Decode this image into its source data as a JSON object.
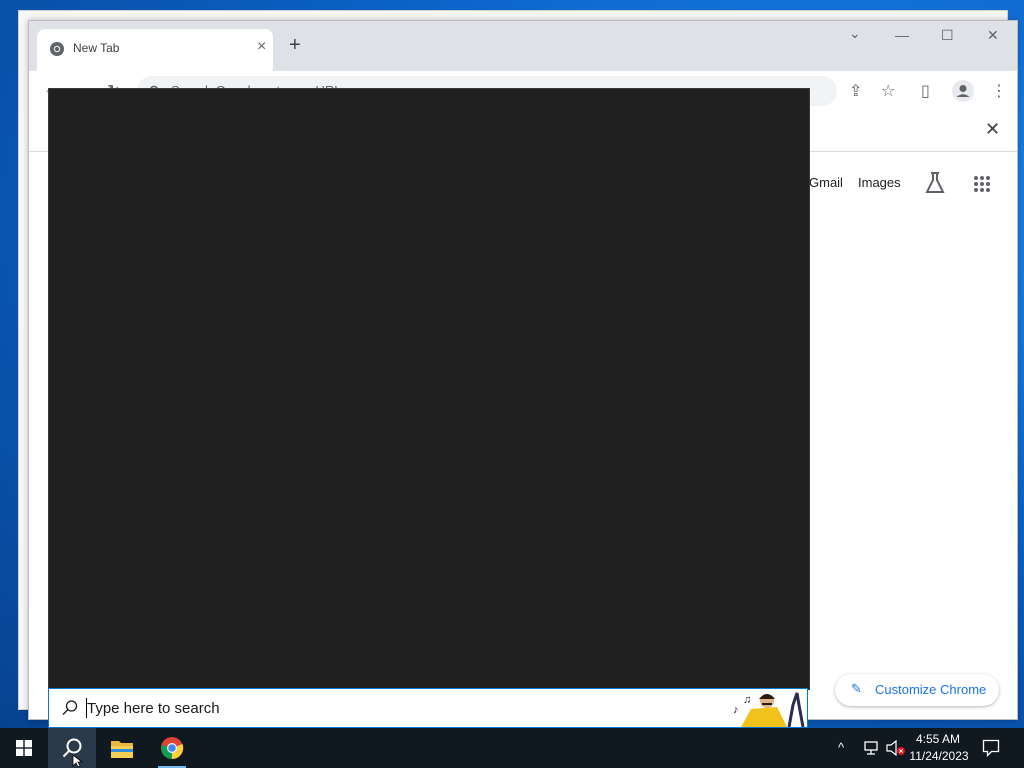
{
  "browser": {
    "tab": {
      "title": "New Tab",
      "close_glyph": "×"
    },
    "new_tab_glyph": "+",
    "window_controls": {
      "tab_search": "⌄",
      "minimize": "—",
      "maximize": "☐",
      "close": "✕"
    },
    "omnibox": {
      "placeholder": "Search Google or type a URL"
    },
    "infobar_close": "✕"
  },
  "ntp": {
    "links": {
      "gmail": "Gmail",
      "images": "Images"
    },
    "customize_label": "Customize Chrome"
  },
  "search": {
    "placeholder": "Type here to search"
  },
  "taskbar": {
    "clock_time": "4:55 AM",
    "clock_date": "11/24/2023"
  },
  "colors": {
    "search_panel": "#202020",
    "taskbar": "#101820",
    "accent": "#1a73e8"
  }
}
